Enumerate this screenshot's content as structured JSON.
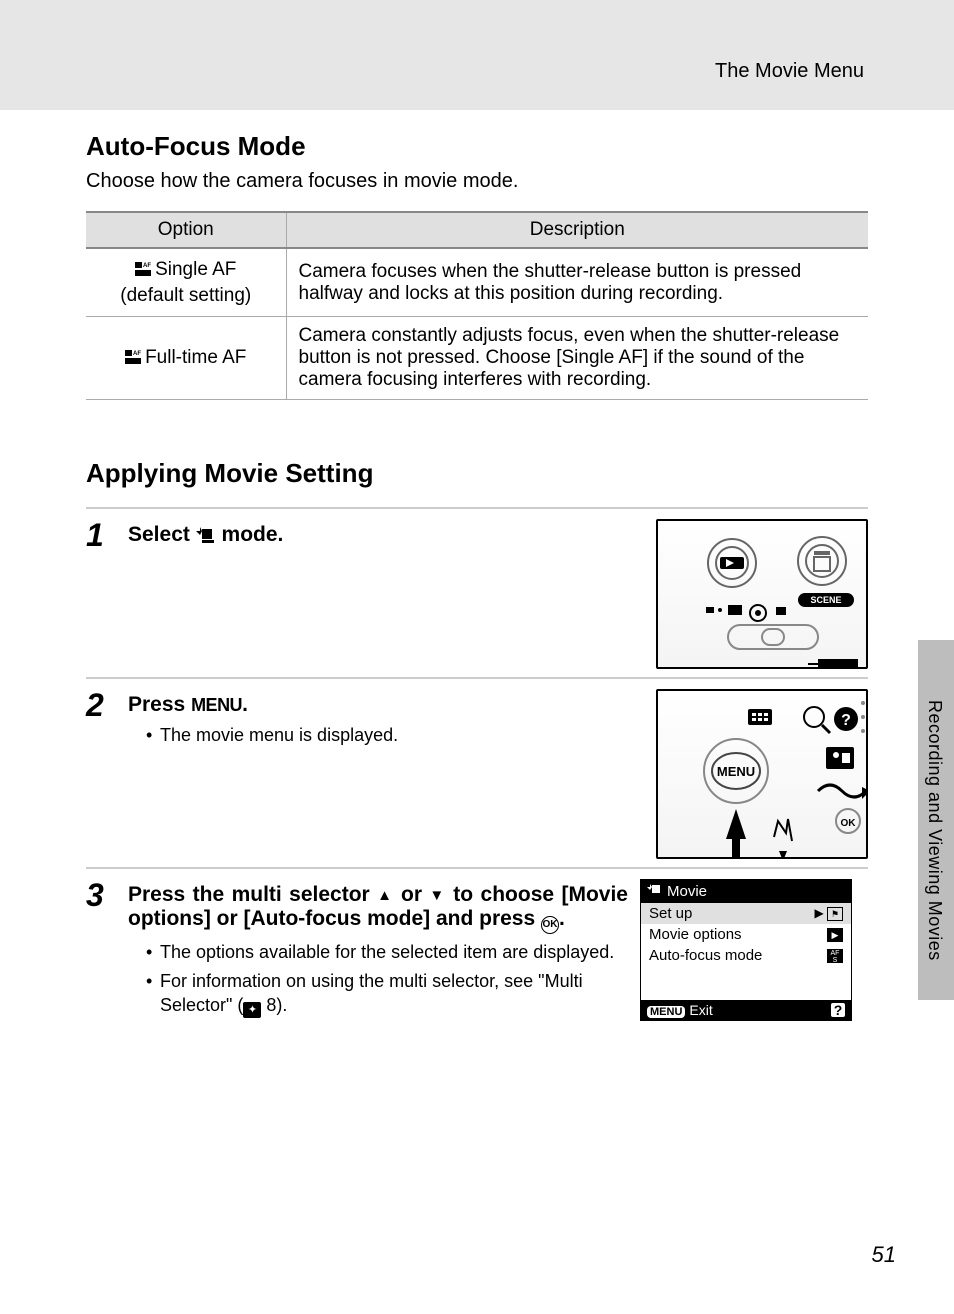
{
  "header": {
    "title": "The Movie Menu"
  },
  "section1": {
    "heading": "Auto-Focus Mode",
    "intro": "Choose how the camera focuses in movie mode.",
    "table": {
      "head_option": "Option",
      "head_desc": "Description",
      "rows": [
        {
          "option_l1": "Single AF",
          "option_l2": "(default setting)",
          "desc": "Camera focuses when the shutter-release button is pressed halfway and locks at this position during recording."
        },
        {
          "option_l1": "Full-time AF",
          "option_l2": "",
          "desc": "Camera constantly adjusts focus, even when the shutter-release button is not pressed. Choose [Single AF] if the sound of the camera focusing interferes with recording."
        }
      ]
    }
  },
  "section2": {
    "heading": "Applying Movie Setting",
    "steps": {
      "s1": {
        "num": "1",
        "title_pre": "Select ",
        "title_post": " mode."
      },
      "s2": {
        "num": "2",
        "title_pre": "Press ",
        "title_menu": "MENU",
        "title_post": ".",
        "bullet1": "The movie menu is displayed."
      },
      "s3": {
        "num": "3",
        "title": "Press the multi selector ▲ or ▼ to choose [Movie options] or [Auto-focus mode] and press ",
        "title_post": ".",
        "bullet1": "The options available for the selected item are displayed.",
        "bullet2_pre": "For information on using the multi selector, see \"Multi Selector\" (",
        "bullet2_ref": " 8).",
        "menu": {
          "title": "Movie",
          "row1": "Set up",
          "row2": "Movie options",
          "row3": "Auto-focus mode",
          "footer_menu": "MENU",
          "footer_exit": "Exit",
          "footer_help": "?"
        }
      }
    }
  },
  "sidebar": {
    "text": "Recording and Viewing Movies"
  },
  "page_number": "51"
}
